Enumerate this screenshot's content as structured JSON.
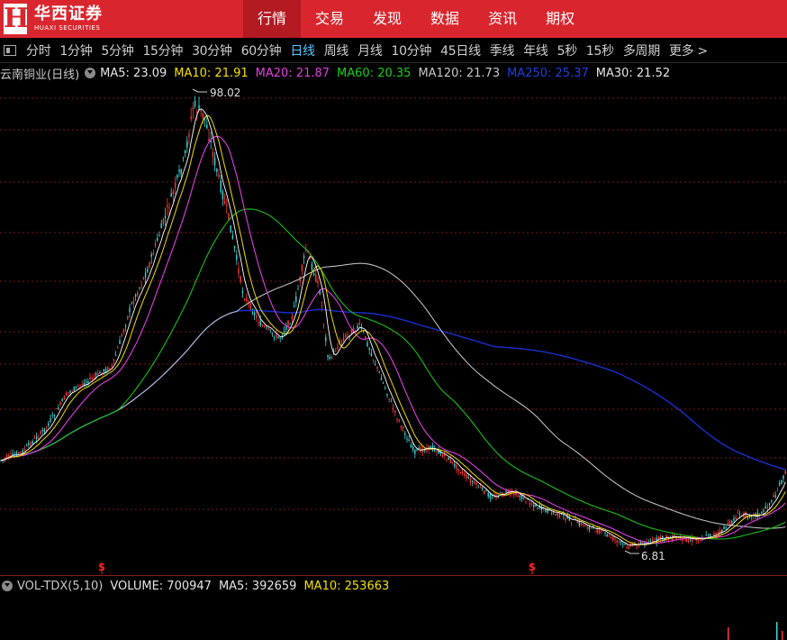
{
  "header": {
    "logo_mark": "H",
    "logo_name": "华西证券",
    "logo_en": "HUAXI SECURITIES",
    "nav": [
      {
        "label": "行情",
        "active": true
      },
      {
        "label": "交易",
        "active": false
      },
      {
        "label": "发现",
        "active": false
      },
      {
        "label": "数据",
        "active": false
      },
      {
        "label": "资讯",
        "active": false
      },
      {
        "label": "期权",
        "active": false
      }
    ]
  },
  "periods": [
    {
      "label": "分时",
      "active": false
    },
    {
      "label": "1分钟",
      "active": false
    },
    {
      "label": "5分钟",
      "active": false
    },
    {
      "label": "15分钟",
      "active": false
    },
    {
      "label": "30分钟",
      "active": false
    },
    {
      "label": "60分钟",
      "active": false
    },
    {
      "label": "日线",
      "active": true
    },
    {
      "label": "周线",
      "active": false
    },
    {
      "label": "月线",
      "active": false
    },
    {
      "label": "10分钟",
      "active": false
    },
    {
      "label": "45日线",
      "active": false
    },
    {
      "label": "季线",
      "active": false
    },
    {
      "label": "年线",
      "active": false
    },
    {
      "label": "5秒",
      "active": false
    },
    {
      "label": "15秒",
      "active": false
    },
    {
      "label": "多周期",
      "active": false
    },
    {
      "label": "更多 >",
      "active": false
    }
  ],
  "stock": {
    "name": "云南铜业(日线)"
  },
  "ma_legend": [
    {
      "text": "MA5: 23.09",
      "color": "#e6e6e6"
    },
    {
      "text": "MA10: 21.91",
      "color": "#f5e000"
    },
    {
      "text": "MA20: 21.87",
      "color": "#e040e0"
    },
    {
      "text": "MA60: 20.35",
      "color": "#18d018"
    },
    {
      "text": "MA120: 21.73",
      "color": "#c8c8c8"
    },
    {
      "text": "MA250: 25.37",
      "color": "#2040e0"
    },
    {
      "text": "MA30: 21.52",
      "color": "#e6e6e6"
    }
  ],
  "chart": {
    "high_label": "98.02",
    "low_label": "6.81",
    "marker": "S",
    "colors": {
      "up": "#ff3b3b",
      "down": "#3fd6d6",
      "grid": "#7a1818",
      "ma250": "#1a2fd0",
      "ma120": "#bdbdbd",
      "ma60": "#18c018",
      "ma20": "#e040e0",
      "ma10": "#f0dc00",
      "ma5": "#ffffff"
    }
  },
  "vol_legend": [
    {
      "text": "VOL-TDX(5,10)",
      "color": "#c8c8c8"
    },
    {
      "text": "VOLUME: 700947",
      "color": "#e6e6e6"
    },
    {
      "text": "MA5: 392659",
      "color": "#e6e6e6"
    },
    {
      "text": "MA10: 253663",
      "color": "#f5e000"
    }
  ]
}
